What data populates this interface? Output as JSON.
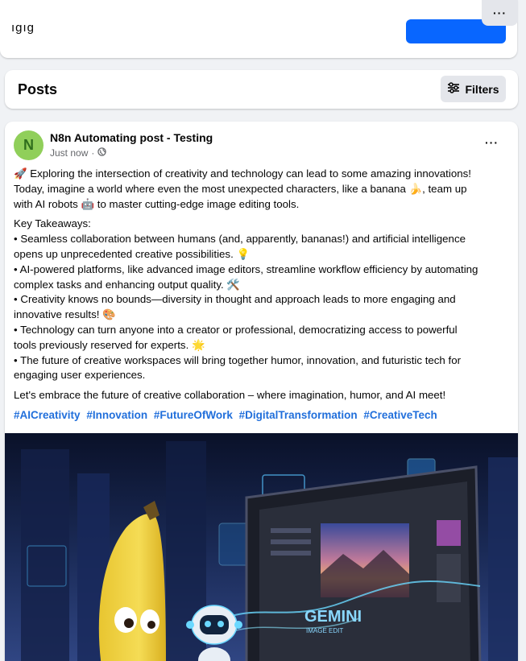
{
  "top_card": {
    "cut_text": "ıgıg",
    "more_label": "···"
  },
  "posts_header": {
    "title": "Posts",
    "filters_label": "Filters"
  },
  "post": {
    "avatar_letter": "N",
    "avatar_color": "#90cf5a",
    "author": "N8n Automating post - Testing",
    "time": "Just now",
    "separator": "·",
    "more_label": "···",
    "intro_lines": [
      "🚀 Exploring the intersection of creativity and technology can lead to some amazing innovations!",
      "Today, imagine a world where even the most unexpected characters, like a banana 🍌, team up",
      "with AI robots 🤖 to master cutting-edge image editing tools."
    ],
    "takeaways_heading": "Key Takeaways:",
    "takeaway_lines": [
      "• Seamless collaboration between humans (and, apparently, bananas!) and artificial intelligence",
      "opens up unprecedented creative possibilities. 💡",
      "• AI-powered platforms, like advanced image editors, streamline workflow efficiency by automating",
      "complex tasks and enhancing output quality. 🛠️",
      "• Creativity knows no bounds—diversity in thought and approach leads to more engaging and",
      "innovative results! 🎨",
      "• Technology can turn anyone into a creator or professional, democratizing access to powerful",
      "tools previously reserved for experts. 🌟",
      "• The future of creative workspaces will bring together humor, innovation, and futuristic tech for",
      "engaging user experiences."
    ],
    "closing": "Let's embrace the future of creative collaboration – where imagination, humor, and AI meet!",
    "hashtags": [
      "#AICreativity",
      "#Innovation",
      "#FutureOfWork",
      "#DigitalTransformation",
      "#CreativeTech"
    ],
    "image": {
      "screen_title": "GEMINI",
      "screen_subtitle": "IMAGE EDIT",
      "hashtag_color": "#216fdb"
    }
  }
}
